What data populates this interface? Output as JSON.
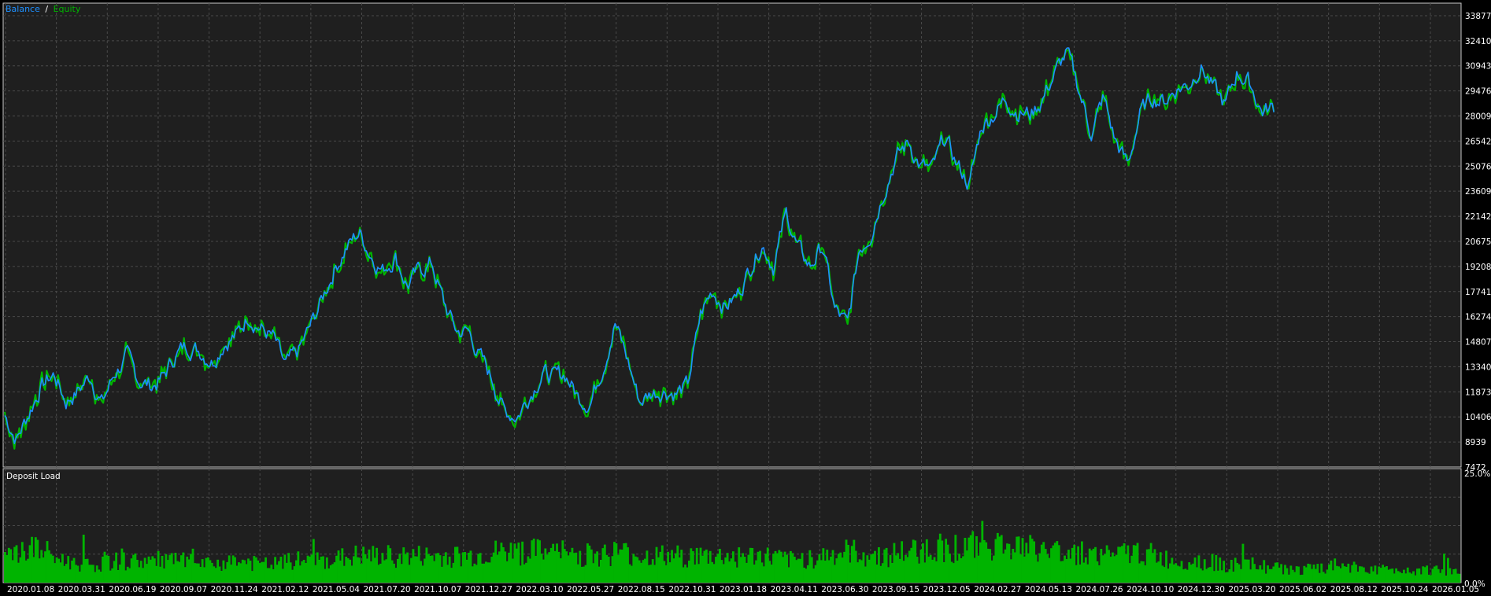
{
  "colors": {
    "background": "#000000",
    "plot_bg": "#1f1f1f",
    "grid": "#4a4a4a",
    "frame": "#c8c8c8",
    "balance": "#1e90ff",
    "equity": "#00b400",
    "deposit_load": "#00b400",
    "text": "#ffffff"
  },
  "legend": {
    "balance_label": "Balance",
    "separator": "/",
    "equity_label": "Equity"
  },
  "deposit_panel": {
    "title": "Deposit Load",
    "y_max_label": "25.0%",
    "y_min_label": "0.0%"
  },
  "chart_data": [
    {
      "type": "line",
      "y_ticks": [
        "33877",
        "32410",
        "30943",
        "29476",
        "28009",
        "26542",
        "25076",
        "23609",
        "22142",
        "20675",
        "19208",
        "17741",
        "16274",
        "14807",
        "13340",
        "11873",
        "10406",
        "8939",
        "7472"
      ],
      "ylim": [
        7472,
        34611
      ],
      "x_tick_labels": [
        "2020.01.08",
        "2020.03.31",
        "2020.06.19",
        "2020.09.07",
        "2020.11.24",
        "2021.02.12",
        "2021.05.04",
        "2021.07.20",
        "2021.10.07",
        "2021.12.27",
        "2022.03.10",
        "2022.05.27",
        "2022.08.15",
        "2022.10.31",
        "2023.01.18",
        "2023.04.11",
        "2023.06.30",
        "2023.09.15",
        "2023.12.05",
        "2024.02.27",
        "2024.05.13",
        "2024.07.26",
        "2024.10.10",
        "2024.12.30",
        "2025.03.20",
        "2025.06.02",
        "2025.08.12",
        "2025.10.24",
        "2026.01.05"
      ],
      "grid": true,
      "series": [
        {
          "name": "Balance",
          "x_fraction": [
            0,
            0.008,
            0.017,
            0.025,
            0.034,
            0.042,
            0.05,
            0.059,
            0.067,
            0.076,
            0.084,
            0.092,
            0.101,
            0.109,
            0.118,
            0.126,
            0.134,
            0.143,
            0.151,
            0.16,
            0.168,
            0.176,
            0.185,
            0.193,
            0.202,
            0.21,
            0.218,
            0.227,
            0.235,
            0.244,
            0.252,
            0.26,
            0.269,
            0.277,
            0.286,
            0.294,
            0.302,
            0.311,
            0.319,
            0.328,
            0.336,
            0.344,
            0.353,
            0.361,
            0.37,
            0.378,
            0.386,
            0.395,
            0.403,
            0.412,
            0.42,
            0.428,
            0.437,
            0.445,
            0.454,
            0.462,
            0.47,
            0.479,
            0.487,
            0.496,
            0.504,
            0.512,
            0.521,
            0.529,
            0.538,
            0.546,
            0.554,
            0.563,
            0.571,
            0.58,
            0.588,
            0.596,
            0.605,
            0.613,
            0.622,
            0.63,
            0.638,
            0.647,
            0.655,
            0.664,
            0.672,
            0.68,
            0.689,
            0.697,
            0.706,
            0.714,
            0.722,
            0.731,
            0.739,
            0.748,
            0.756,
            0.764,
            0.773,
            0.781,
            0.79,
            0.798,
            0.806,
            0.815,
            0.823,
            0.832,
            0.84,
            0.848,
            0.857,
            0.865,
            0.874,
            0.882,
            0.89,
            0.899,
            0.907,
            0.916,
            0.924,
            0.932,
            0.941,
            0.949,
            0.958,
            0.966,
            0.974,
            0.983,
            0.991,
            1.0
          ],
          "values": [
            10500,
            9100,
            10700,
            12200,
            12900,
            11300,
            11900,
            12800,
            11200,
            13000,
            13900,
            12600,
            12200,
            12700,
            14100,
            14600,
            14300,
            13700,
            14800,
            15200,
            16400,
            15600,
            15000,
            13300,
            14200,
            15600,
            17200,
            19100,
            20300,
            21200,
            19900,
            19000,
            19800,
            18100,
            19000,
            19400,
            17100,
            15400,
            15400,
            13800,
            12500,
            10700,
            10500,
            11700,
            13000,
            12700,
            12900,
            11500,
            11300,
            13500,
            15900,
            13900,
            11300,
            11800,
            12000,
            11800,
            12200,
            16400,
            17800,
            16900,
            17500,
            19000,
            20600,
            19300,
            22300,
            20200,
            19200,
            20400,
            16700,
            15700,
            20200,
            21200,
            23700,
            25500,
            26500,
            25100,
            24800,
            26700,
            25200,
            24000,
            27400,
            28100,
            29000,
            28300,
            28100,
            29000,
            30400,
            31700,
            29600,
            27000,
            29100,
            26600,
            25100,
            28100,
            29100,
            28900,
            29600,
            29900,
            31000,
            29600,
            28600,
            30600,
            29900,
            28300,
            28500
          ]
        },
        {
          "name": "Equity"
        }
      ]
    },
    {
      "type": "bar",
      "title": "Deposit Load",
      "ylim": [
        0,
        25
      ],
      "y_tick_labels": [
        "25.0%",
        "0.0%"
      ],
      "values_fraction_x": [
        0.0,
        0.02,
        0.04,
        0.06,
        0.08,
        0.1,
        0.12,
        0.14,
        0.16,
        0.18,
        0.2,
        0.22,
        0.24,
        0.26,
        0.28,
        0.3,
        0.32,
        0.34,
        0.36,
        0.38,
        0.4,
        0.42,
        0.44,
        0.46,
        0.48,
        0.5,
        0.52,
        0.54,
        0.56,
        0.58,
        0.6,
        0.62,
        0.64,
        0.66,
        0.68,
        0.7,
        0.72,
        0.74,
        0.76,
        0.78,
        0.8,
        0.82,
        0.84,
        0.86,
        0.88,
        0.9,
        0.92,
        0.94,
        0.96,
        0.98,
        1.0
      ],
      "values": [
        6,
        8,
        5,
        4,
        5,
        5,
        5,
        4,
        5,
        4,
        5,
        5,
        6,
        6,
        6,
        6,
        6,
        7,
        7,
        7,
        6,
        7,
        6,
        6,
        6,
        6,
        6,
        5,
        6,
        7,
        6,
        7,
        8,
        8,
        9,
        8,
        7,
        7,
        6,
        7,
        5,
        5,
        4,
        4,
        3,
        3,
        4,
        3,
        3,
        3,
        2
      ]
    }
  ]
}
